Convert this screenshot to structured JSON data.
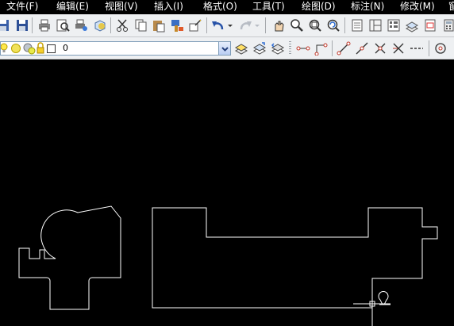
{
  "menu": {
    "items": [
      {
        "label": "文件(F)"
      },
      {
        "label": "编辑(E)"
      },
      {
        "label": "视图(V)"
      },
      {
        "label": "插入(I)"
      },
      {
        "label": "格式(O)"
      },
      {
        "label": "工具(T)"
      },
      {
        "label": "绘图(D)"
      },
      {
        "label": "标注(N)"
      },
      {
        "label": "修改(M)"
      },
      {
        "label": "窗"
      }
    ]
  },
  "layers": {
    "current_layer": "0",
    "icons": [
      "lightbulb-icon",
      "sun-icon",
      "freeze-viewport-icon",
      "lock-icon",
      "color-swatch-icon"
    ]
  },
  "toolbar1": {
    "icons": [
      "save-icon",
      "print-icon",
      "print-preview-icon",
      "publish-icon",
      "3d-dwf-icon",
      "cut-icon",
      "copy-icon",
      "paste-icon",
      "match-properties-icon",
      "block-editor-icon",
      "undo-icon",
      "undo-dropdown-icon",
      "redo-icon",
      "redo-dropdown-icon",
      "pan-icon",
      "zoom-realtime-icon",
      "zoom-window-icon",
      "zoom-previous-icon",
      "properties-icon",
      "design-center-icon",
      "tool-palettes-icon",
      "sheet-set-icon",
      "markup-icon",
      "calculator-icon"
    ]
  },
  "toolbar2": {
    "icons": [
      "layer-properties-icon",
      "make-current-layer-icon",
      "layer-previous-icon",
      "linear-dim-icon",
      "aligned-dim-icon",
      "line-icon",
      "construction-line-icon",
      "intersection-snap-icon",
      "perpendicular-icon",
      "polyline-icon",
      "circle-icon"
    ]
  },
  "colors": {
    "canvas": "#000000",
    "geometry": "#ffffff",
    "toolbar": "#eef0f2",
    "menu_text": "#ffffff"
  }
}
